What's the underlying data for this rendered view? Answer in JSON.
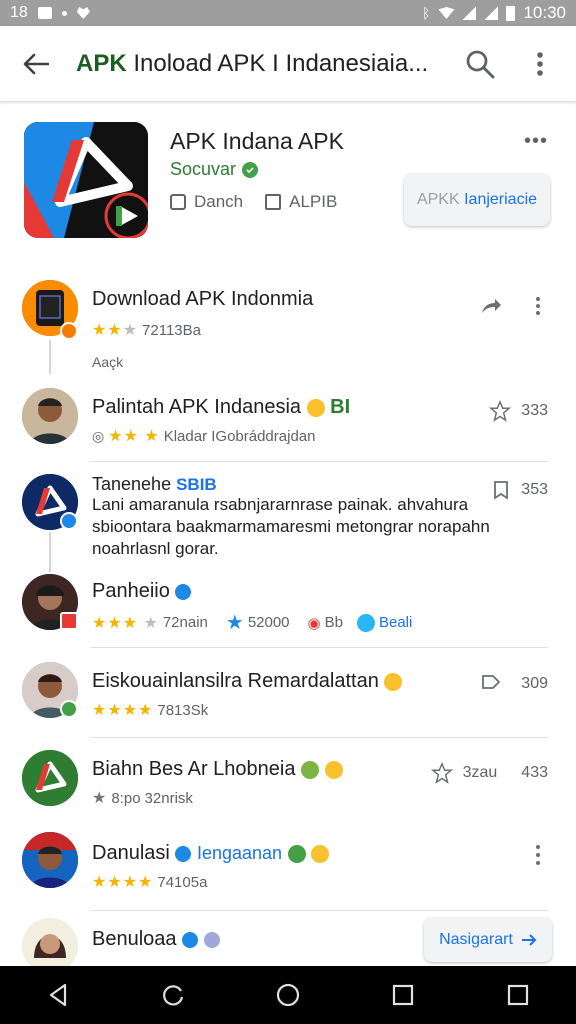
{
  "status_bar": {
    "left_text": "18",
    "time": "10:30"
  },
  "app_bar": {
    "title_bold": "APK",
    "title_rest": " Inoload APK I Indanesiaia..."
  },
  "app": {
    "name": "APK Indana APK",
    "developer": "Socuvar",
    "meta_1": "Danch",
    "meta_2": "ALPIB",
    "install_label_gray": "APKK",
    "install_label_accent": "Ianjeriacie"
  },
  "rows": [
    {
      "title": "Download APK Indonmia",
      "rating_text": "72113Ba",
      "extra": "Aaçk"
    },
    {
      "title": "Palintah APK Indanesia",
      "title_badge": "BI",
      "sub": "Kladar IGobráddrajdan",
      "right": "333"
    },
    {
      "title": "Tanenehe",
      "title_badge": "SBIB",
      "right": "353",
      "body": "Lani amaranula rsabnjararnrase painak. ahvahura sbioontara baakmarmamaresmi metongrar norapahn noahrlasnl gorar."
    },
    {
      "title": "Panheiio",
      "rating_text": "72nain",
      "stat_1": "52000",
      "stat_2": "Bb",
      "stat_3": "Beali"
    },
    {
      "title": "Eiskouainlansilra Remardalattan",
      "rating_text": "7813Sk",
      "right": "309"
    },
    {
      "title": "Biahn Bes Ar Lhobneia",
      "rating_text": "8:po",
      "rating_text_2": "32nrisk",
      "right_a": "3zau",
      "right_b": "433"
    },
    {
      "title": "Danulasi",
      "title_link": "Iengaanan",
      "rating_text": "74105a"
    },
    {
      "title": "Benuloaa",
      "next_label": "Nasigarart"
    }
  ],
  "colors": {
    "accent": "#1a73e8",
    "green": "#2e7d32",
    "star": "#f4b400"
  }
}
